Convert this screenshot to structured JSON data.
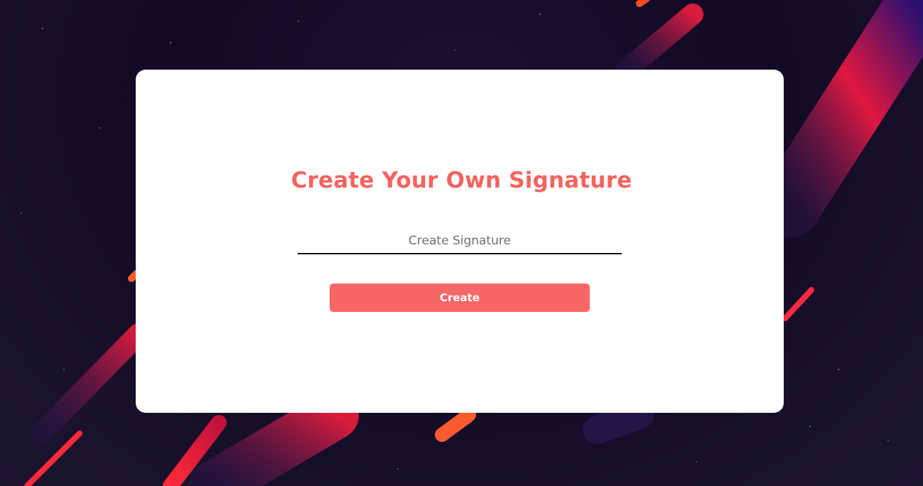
{
  "page": {
    "title": "Create Your Own Signature"
  },
  "form": {
    "signature_placeholder": "Create Signature",
    "signature_value": "",
    "create_label": "Create"
  },
  "colors": {
    "accent": "#f4645f",
    "button": "#f86767",
    "background": "#120a24"
  }
}
